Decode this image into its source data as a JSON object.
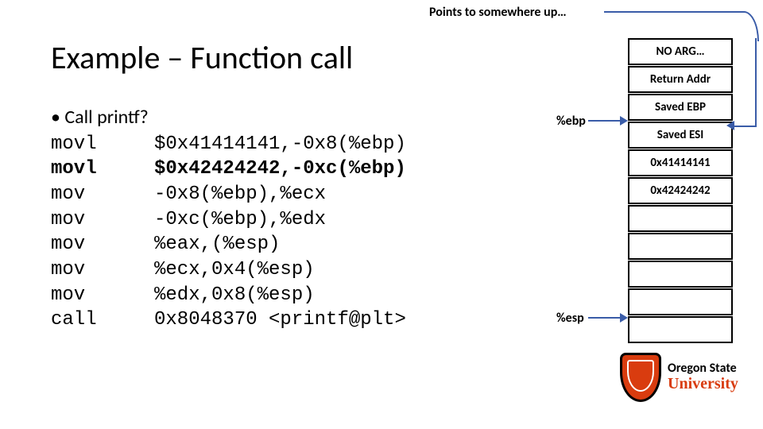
{
  "top_caption": "Points to somewhere up…",
  "title": "Example – Function call",
  "bullet": "• Call printf?",
  "code": [
    {
      "mn": "movl",
      "args": "$0x41414141,-0x8(%ebp)",
      "bold": false
    },
    {
      "mn": "movl",
      "args": "$0x42424242,-0xc(%ebp)",
      "bold": true
    },
    {
      "mn": "mov",
      "args": "-0x8(%ebp),%ecx",
      "bold": false
    },
    {
      "mn": "mov",
      "args": "-0xc(%ebp),%edx",
      "bold": false
    },
    {
      "mn": "mov",
      "args": "%eax,(%esp)",
      "bold": false
    },
    {
      "mn": "mov",
      "args": "%ecx,0x4(%esp)",
      "bold": false
    },
    {
      "mn": "mov",
      "args": "%edx,0x8(%esp)",
      "bold": false
    },
    {
      "mn": "call",
      "args": "0x8048370 <printf@plt>",
      "bold": false
    }
  ],
  "labels": {
    "ebp": "%ebp",
    "esp": "%esp"
  },
  "stack": [
    "NO ARG…",
    "Return Addr",
    "Saved EBP",
    "Saved ESI",
    "0x41414141",
    "0x42424242",
    "",
    "",
    "",
    "",
    ""
  ],
  "logo": {
    "line1": "Oregon State",
    "line2": "University"
  }
}
